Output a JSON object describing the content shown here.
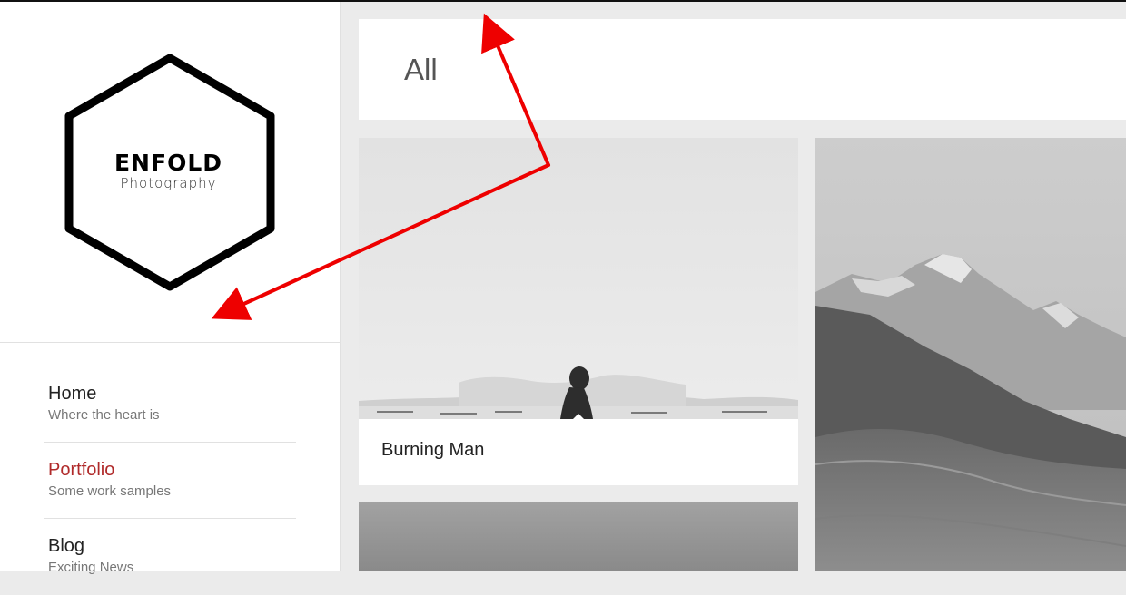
{
  "logo": {
    "title": "ENFOLD",
    "subtitle": "Photography"
  },
  "nav": {
    "items": [
      {
        "label": "Home",
        "sub": "Where the heart is",
        "active": false
      },
      {
        "label": "Portfolio",
        "sub": "Some work samples",
        "active": true
      },
      {
        "label": "Blog",
        "sub": "Exciting News",
        "active": false
      }
    ]
  },
  "filter": {
    "title": "All"
  },
  "portfolio": {
    "items": [
      {
        "caption": "Burning Man"
      }
    ]
  },
  "colors": {
    "accent": "#b02a2a",
    "annotation_arrow": "#ee0000",
    "page_bg": "#ebebeb"
  }
}
